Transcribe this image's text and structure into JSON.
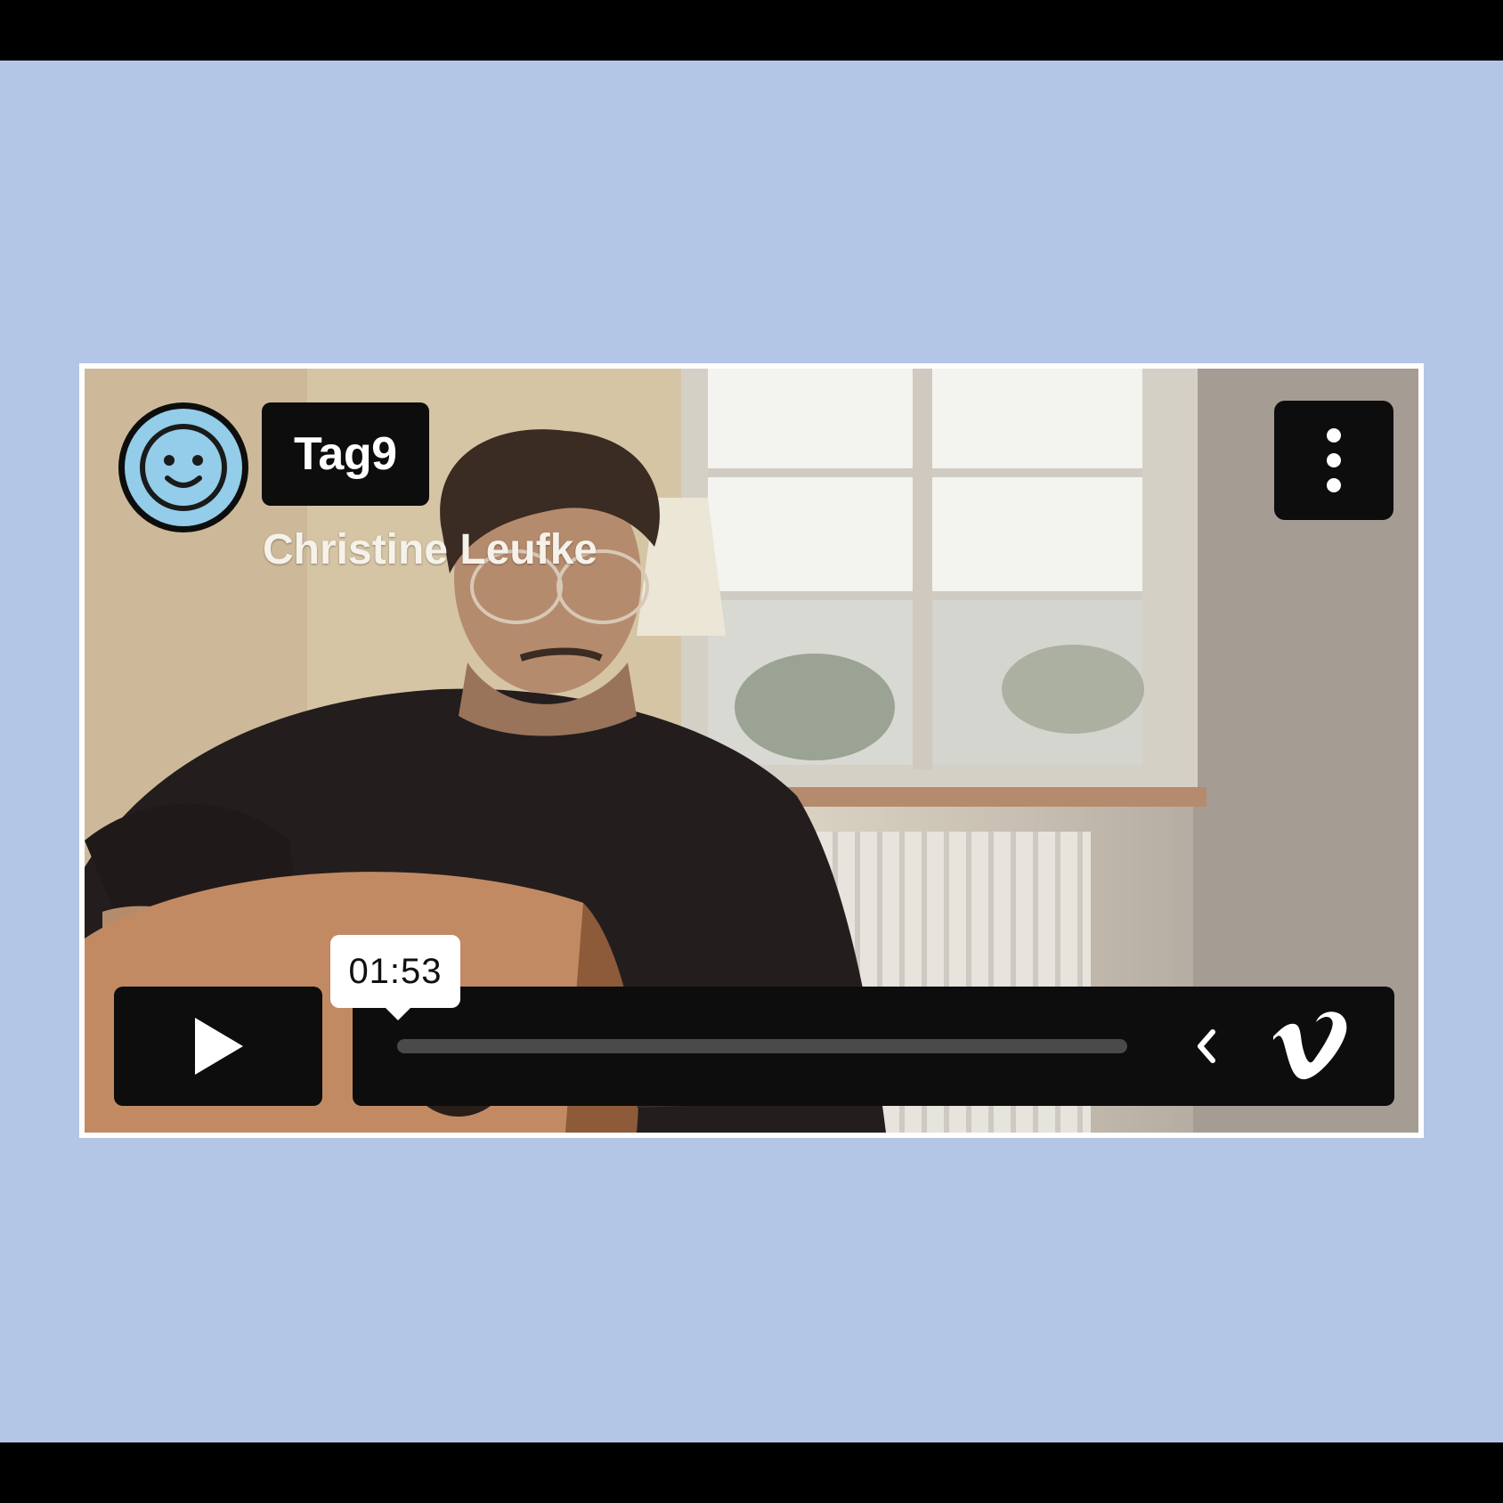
{
  "video": {
    "title": "Tag9",
    "byline": "Christine Leufke"
  },
  "controls": {
    "hover_time": "01:53",
    "progress": 0.0,
    "play_icon": "play-icon",
    "menu_icon": "vertical-dots-icon",
    "collapse_icon": "chevron-left-icon",
    "brand_icon": "vimeo-logo-icon"
  },
  "colors": {
    "page_background": "#b4c6e6",
    "frame": "#000000",
    "control_background": "#0d0d0d",
    "avatar": "#93cde9"
  }
}
